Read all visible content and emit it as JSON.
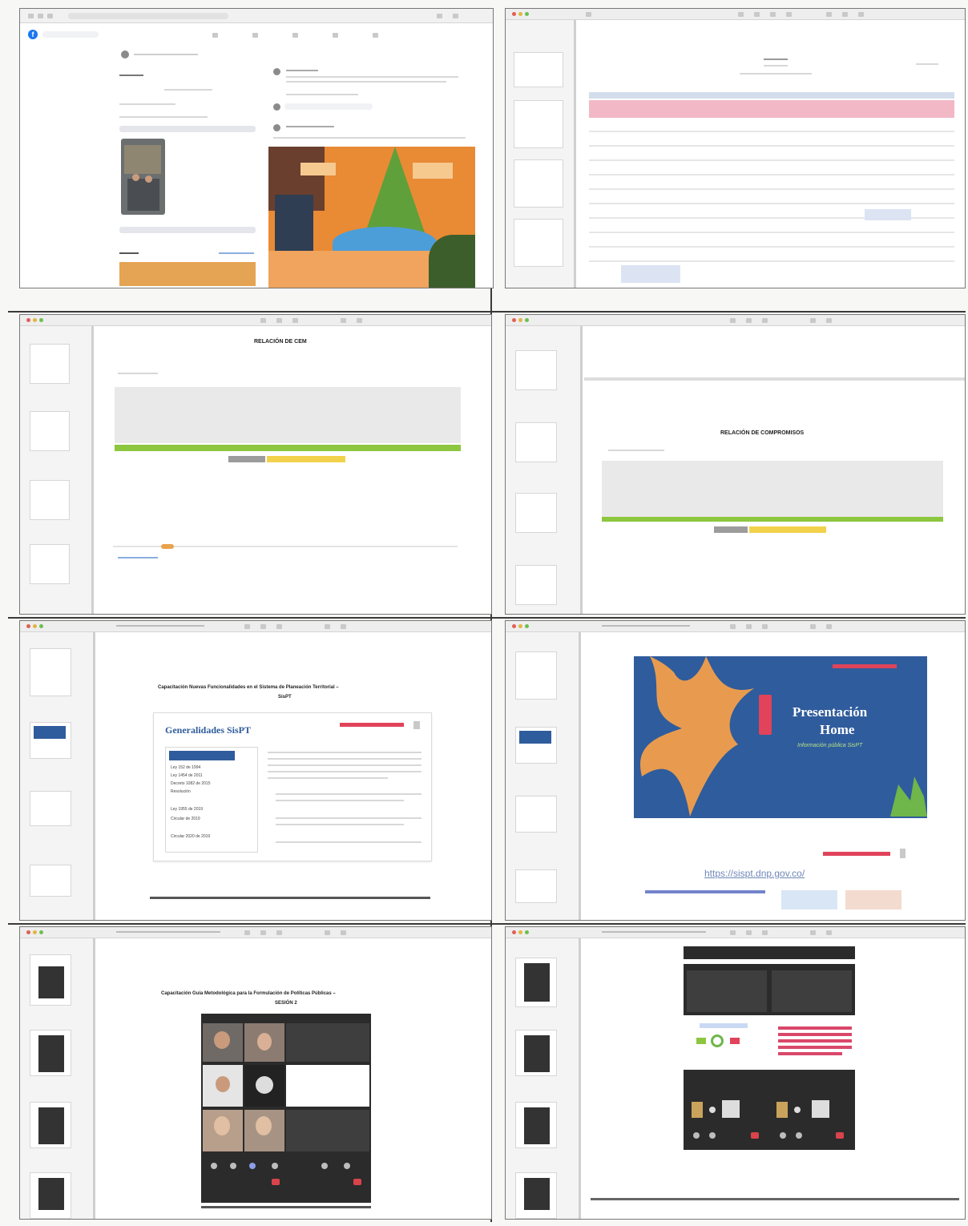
{
  "panels": {
    "facebook": {
      "logo_letter": "f"
    },
    "relacion_cem": {
      "title": "RELACIÓN DE CEM"
    },
    "relacion_compromisos": {
      "title": "RELACIÓN DE COMPROMISOS"
    },
    "capacitacion_sispt": {
      "title_line1": "Capacitación Nuevas Funcionalidades en el Sistema de Planeación Territorial –",
      "title_line2": "SisPT",
      "slide_heading": "Generalidades SisPT",
      "list_items": [
        "Ley 152 de 1994",
        "Ley 1454 de 2011",
        "Decreto 1082 de 2015",
        "Resolución",
        "Ley 1955 de 2019",
        "Circular de 2019",
        "Circular 2020 de 2019"
      ]
    },
    "presentacion_home": {
      "title_line1": "Presentación",
      "title_line2": "Home",
      "subtitle": "Información pública SisPT",
      "url": "https://sispt.dnp.gov.co/"
    },
    "capacitacion_guia": {
      "title_line1": "Capacitación Guía Metodológica para la Formulación de Políticas Públicas –",
      "title_line2": "SESIÓN 2"
    }
  },
  "colors": {
    "facebook_blue": "#1877f2",
    "slide_blue": "#2f5c9c",
    "leaf_orange": "#e89b4e",
    "accent_red": "#e0435a",
    "bar_green": "#8dc63f",
    "bar_yellow": "#f2d24b",
    "highlight_pink": "#f2b8c6"
  }
}
